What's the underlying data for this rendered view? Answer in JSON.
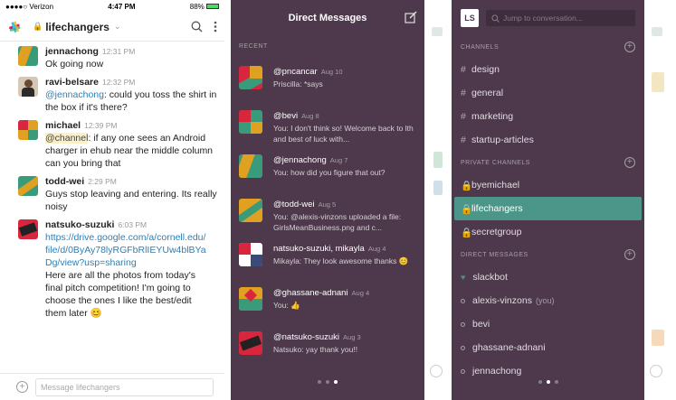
{
  "status": {
    "carrier": "●●●●○ Verizon",
    "time": "4:47 PM",
    "battery": "88%"
  },
  "channel": {
    "name": "lifechangers",
    "lock": "🔒",
    "caret": "⌄",
    "search_icon": "search-icon",
    "menu_icon": "more-vert-icon"
  },
  "messages": [
    {
      "name": "jennachong",
      "time": "12:31 PM",
      "text": "Ok going now",
      "avatar_color": "#3a9b7a"
    },
    {
      "name": "ravi-belsare",
      "time": "12:32 PM",
      "mention": "@jennachong",
      "text": ": could you toss the shirt in the box if it's there?",
      "avatar_color": "#d6c7b6"
    },
    {
      "name": "michael",
      "time": "12:39 PM",
      "mention": "@channel",
      "text": ": if any one sees an Android charger in ehub near the middle column can you bring that",
      "avatar_color": "#e0a021"
    },
    {
      "name": "todd-wei",
      "time": "2:29 PM",
      "text": "Guys stop leaving and entering. Its really noisy",
      "avatar_color": "#3a9b7a"
    },
    {
      "name": "natsuko-suzuki",
      "time": "6:03 PM",
      "link": "https://drive.google.com/a/cornell.edu/file/d/0ByAy78lyRGFbRlIEYUw4blBYaDg/view?usp=sharing",
      "text": "Here are all the photos from today's final pitch competition! I'm going to choose the ones I like the best/edit them later 😊",
      "avatar_color": "#d7263d"
    }
  ],
  "compose": {
    "placeholder": "Message lifechangers",
    "plus": "+"
  },
  "dm_panel": {
    "title": "Direct Messages",
    "section": "RECENT",
    "items": [
      {
        "name": "@pncancar",
        "date": "Aug 10",
        "preview": "Priscilla: *says"
      },
      {
        "name": "@bevi",
        "date": "Aug 8",
        "preview": "You: I don't think so! Welcome back to lth and best of luck with..."
      },
      {
        "name": "@jennachong",
        "date": "Aug 7",
        "preview": "You: how did you figure that out?"
      },
      {
        "name": "@todd-wei",
        "date": "Aug 5",
        "preview": "You: @alexis-vinzons uploaded a file: GirlsMeanBusiness.png and c..."
      },
      {
        "name": "natsuko-suzuki, mikayla",
        "date": "Aug 4",
        "preview": "Mikayla: They look awesome thanks 😊"
      },
      {
        "name": "@ghassane-adnani",
        "date": "Aug 4",
        "preview": "You: 👍"
      },
      {
        "name": "@natsuko-suzuki",
        "date": "Aug 3",
        "preview": "Natsuko: yay thank you!!"
      }
    ]
  },
  "sidebar": {
    "initials": "LS",
    "search_placeholder": "Jump to conversation...",
    "channels_label": "CHANNELS",
    "channels": [
      "design",
      "general",
      "marketing",
      "startup-articles"
    ],
    "private_label": "PRIVATE CHANNELS",
    "private": [
      "byemichael",
      "lifechangers",
      "secretgroup"
    ],
    "dm_label": "DIRECT MESSAGES",
    "dms": [
      {
        "name": "slackbot",
        "you": "",
        "online": true
      },
      {
        "name": "alexis-vinzons",
        "you": "(you)",
        "online": false
      },
      {
        "name": "bevi",
        "you": "",
        "online": false
      },
      {
        "name": "ghassane-adnani",
        "you": "",
        "online": false
      },
      {
        "name": "jennachong",
        "you": "",
        "online": false
      }
    ],
    "selected": "lifechangers"
  },
  "colors": {
    "aubergine": "#4d394b",
    "selected": "#4c9689",
    "link": "#2a80b9"
  }
}
